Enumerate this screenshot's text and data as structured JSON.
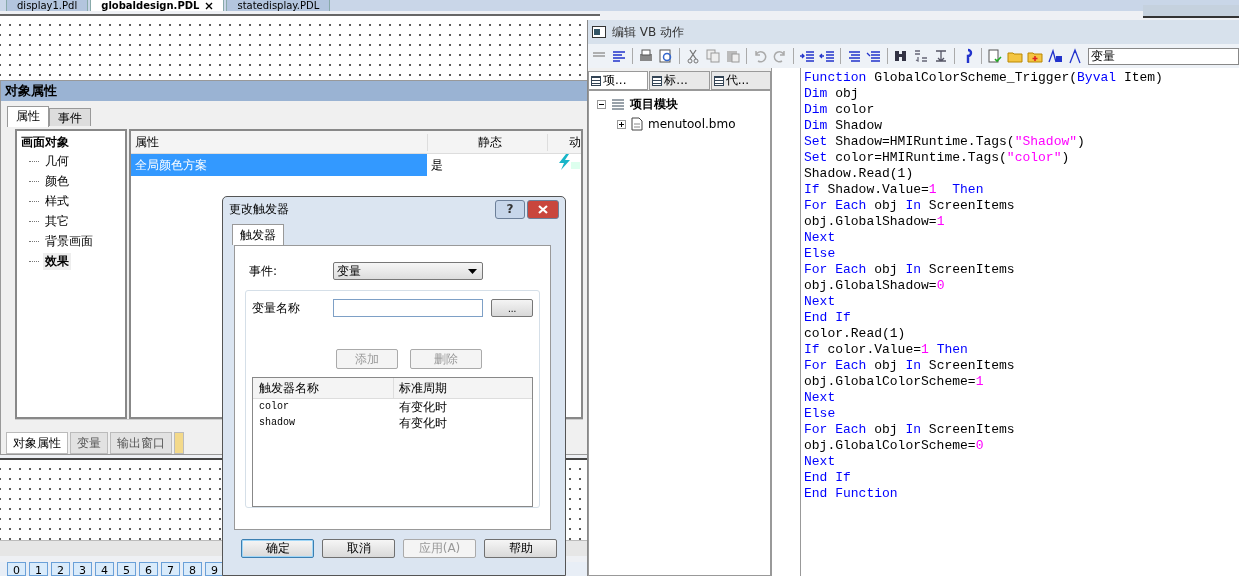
{
  "document_tabs": [
    {
      "label": "display1.Pdl",
      "selected": false,
      "closable": false
    },
    {
      "label": "globaldesign.PDL",
      "selected": true,
      "closable": true
    },
    {
      "label": "statedisplay.PDL",
      "selected": false,
      "closable": false
    }
  ],
  "object_properties": {
    "title": "对象属性",
    "tabs": [
      {
        "label": "属性",
        "selected": true
      },
      {
        "label": "事件",
        "selected": false
      }
    ],
    "tree": {
      "label": "画面对象",
      "children": [
        {
          "label": "几何",
          "selected": false
        },
        {
          "label": "颜色",
          "selected": false
        },
        {
          "label": "样式",
          "selected": false
        },
        {
          "label": "其它",
          "selected": false
        },
        {
          "label": "背景画面",
          "selected": false
        },
        {
          "label": "效果",
          "selected": true
        }
      ]
    },
    "columns": [
      "属性",
      "静态",
      "动"
    ],
    "rows": [
      {
        "property": "全局颜色方案",
        "static": "是",
        "selected": true,
        "has_vb_action": true
      }
    ]
  },
  "bottom_tabs": [
    {
      "label": "对象属性",
      "selected": true
    },
    {
      "label": "变量",
      "selected": false
    },
    {
      "label": "输出窗口",
      "selected": false
    }
  ],
  "number_bar": [
    "0",
    "1",
    "2",
    "3",
    "4",
    "5",
    "6",
    "7",
    "8",
    "9"
  ],
  "dialog": {
    "title": "更改触发器",
    "help_glyph": "?",
    "tabs": [
      {
        "label": "触发器",
        "selected": true
      }
    ],
    "event_label": "事件:",
    "event_value": "变量",
    "tag_label": "变量名称",
    "browse_label": "...",
    "add_button": {
      "label": "添加",
      "disabled": true
    },
    "delete_button": {
      "label": "删除",
      "disabled": true
    },
    "columns": [
      "触发器名称",
      "标准周期"
    ],
    "triggers": [
      {
        "name": "color",
        "cycle": "有变化时"
      },
      {
        "name": "shadow",
        "cycle": "有变化时"
      }
    ],
    "buttons": [
      {
        "label": "确定",
        "disabled": false,
        "default": true
      },
      {
        "label": "取消",
        "disabled": false,
        "default": false
      },
      {
        "label": "应用(A)",
        "disabled": true,
        "default": false
      },
      {
        "label": "帮助",
        "disabled": false,
        "default": false
      }
    ]
  },
  "vb_editor": {
    "title": "编辑 VB 动作",
    "search_value": "变量",
    "pane_tabs": [
      {
        "label": "项...",
        "selected": true
      },
      {
        "label": "标...",
        "selected": false
      },
      {
        "label": "代...",
        "selected": false
      }
    ],
    "tree": {
      "label": "项目模块",
      "children": [
        {
          "label": "menutool.bmo"
        }
      ]
    },
    "code": [
      [
        {
          "kind": "k",
          "text": "Function"
        },
        {
          "kind": "t",
          "text": " GlobalColorScheme_Trigger("
        },
        {
          "kind": "k",
          "text": "Byval"
        },
        {
          "kind": "t",
          "text": " Item)"
        }
      ],
      [
        {
          "kind": "k",
          "text": "Dim"
        },
        {
          "kind": "t",
          "text": " obj"
        }
      ],
      [
        {
          "kind": "k",
          "text": "Dim"
        },
        {
          "kind": "t",
          "text": " color"
        }
      ],
      [
        {
          "kind": "k",
          "text": "Dim"
        },
        {
          "kind": "t",
          "text": " Shadow"
        }
      ],
      [
        {
          "kind": "k",
          "text": "Set"
        },
        {
          "kind": "t",
          "text": " Shadow=HMIRuntime.Tags("
        },
        {
          "kind": "s",
          "text": "\"Shadow\""
        },
        {
          "kind": "t",
          "text": ")"
        }
      ],
      [
        {
          "kind": "k",
          "text": "Set"
        },
        {
          "kind": "t",
          "text": " color=HMIRuntime.Tags("
        },
        {
          "kind": "s",
          "text": "\"color\""
        },
        {
          "kind": "t",
          "text": ")"
        }
      ],
      [
        {
          "kind": "t",
          "text": "Shadow.Read(1)"
        }
      ],
      [
        {
          "kind": "k",
          "text": "If"
        },
        {
          "kind": "t",
          "text": " Shadow.Value="
        },
        {
          "kind": "n",
          "text": "1"
        },
        {
          "kind": "k",
          "text": "  Then"
        }
      ],
      [
        {
          "kind": "k",
          "text": "For Each"
        },
        {
          "kind": "t",
          "text": " obj "
        },
        {
          "kind": "k",
          "text": "In"
        },
        {
          "kind": "t",
          "text": " ScreenItems"
        }
      ],
      [
        {
          "kind": "t",
          "text": "obj.GlobalShadow="
        },
        {
          "kind": "n",
          "text": "1"
        }
      ],
      [
        {
          "kind": "k",
          "text": "Next"
        }
      ],
      [
        {
          "kind": "k",
          "text": "Else"
        }
      ],
      [
        {
          "kind": "k",
          "text": "For Each"
        },
        {
          "kind": "t",
          "text": " obj "
        },
        {
          "kind": "k",
          "text": "In"
        },
        {
          "kind": "t",
          "text": " ScreenItems"
        }
      ],
      [
        {
          "kind": "t",
          "text": "obj.GlobalShadow="
        },
        {
          "kind": "n",
          "text": "0"
        }
      ],
      [
        {
          "kind": "k",
          "text": "Next"
        }
      ],
      [
        {
          "kind": "k",
          "text": "End If"
        }
      ],
      [
        {
          "kind": "t",
          "text": "color.Read(1)"
        }
      ],
      [
        {
          "kind": "k",
          "text": "If"
        },
        {
          "kind": "t",
          "text": " color.Value="
        },
        {
          "kind": "n",
          "text": "1"
        },
        {
          "kind": "k",
          "text": " Then"
        }
      ],
      [
        {
          "kind": "k",
          "text": "For Each"
        },
        {
          "kind": "t",
          "text": " obj "
        },
        {
          "kind": "k",
          "text": "In"
        },
        {
          "kind": "t",
          "text": " ScreenItems"
        }
      ],
      [
        {
          "kind": "t",
          "text": "obj.GlobalColorScheme="
        },
        {
          "kind": "n",
          "text": "1"
        }
      ],
      [
        {
          "kind": "k",
          "text": "Next"
        }
      ],
      [
        {
          "kind": "k",
          "text": "Else"
        }
      ],
      [
        {
          "kind": "k",
          "text": "For Each"
        },
        {
          "kind": "t",
          "text": " obj "
        },
        {
          "kind": "k",
          "text": "In"
        },
        {
          "kind": "t",
          "text": " ScreenItems"
        }
      ],
      [
        {
          "kind": "t",
          "text": "obj.GlobalColorScheme="
        },
        {
          "kind": "n",
          "text": "0"
        }
      ],
      [
        {
          "kind": "k",
          "text": "Next"
        }
      ],
      [
        {
          "kind": "k",
          "text": "End If"
        }
      ],
      [
        {
          "kind": "k",
          "text": "End Function"
        }
      ]
    ]
  }
}
